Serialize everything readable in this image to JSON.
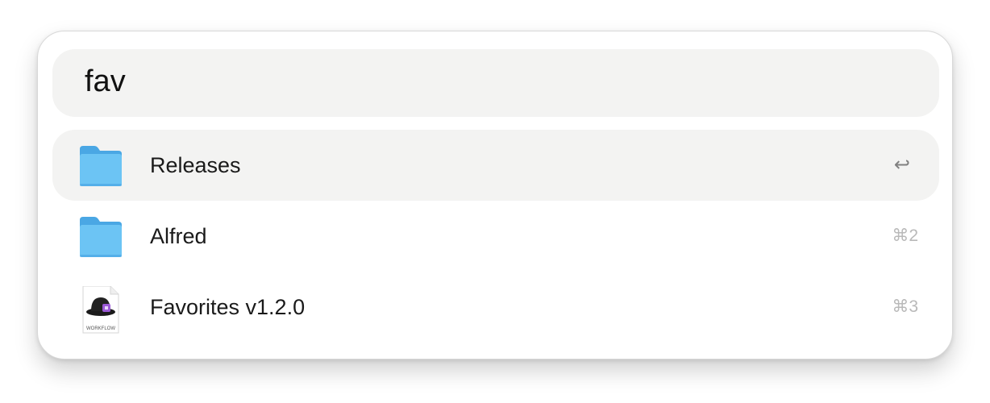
{
  "search": {
    "query": "fav"
  },
  "results": [
    {
      "title": "Releases",
      "icon": "folder-icon",
      "action_glyph": "↩",
      "selected": true
    },
    {
      "title": "Alfred",
      "icon": "folder-icon",
      "shortcut": "⌘2"
    },
    {
      "title": "Favorites v1.2.0",
      "icon": "workflow-file-icon",
      "icon_caption": "WORKFLOW",
      "shortcut": "⌘3"
    }
  ],
  "colors": {
    "selection": "#f3f3f2",
    "folder": "#6cc4f4",
    "folder_tab": "#4aa7e4"
  }
}
